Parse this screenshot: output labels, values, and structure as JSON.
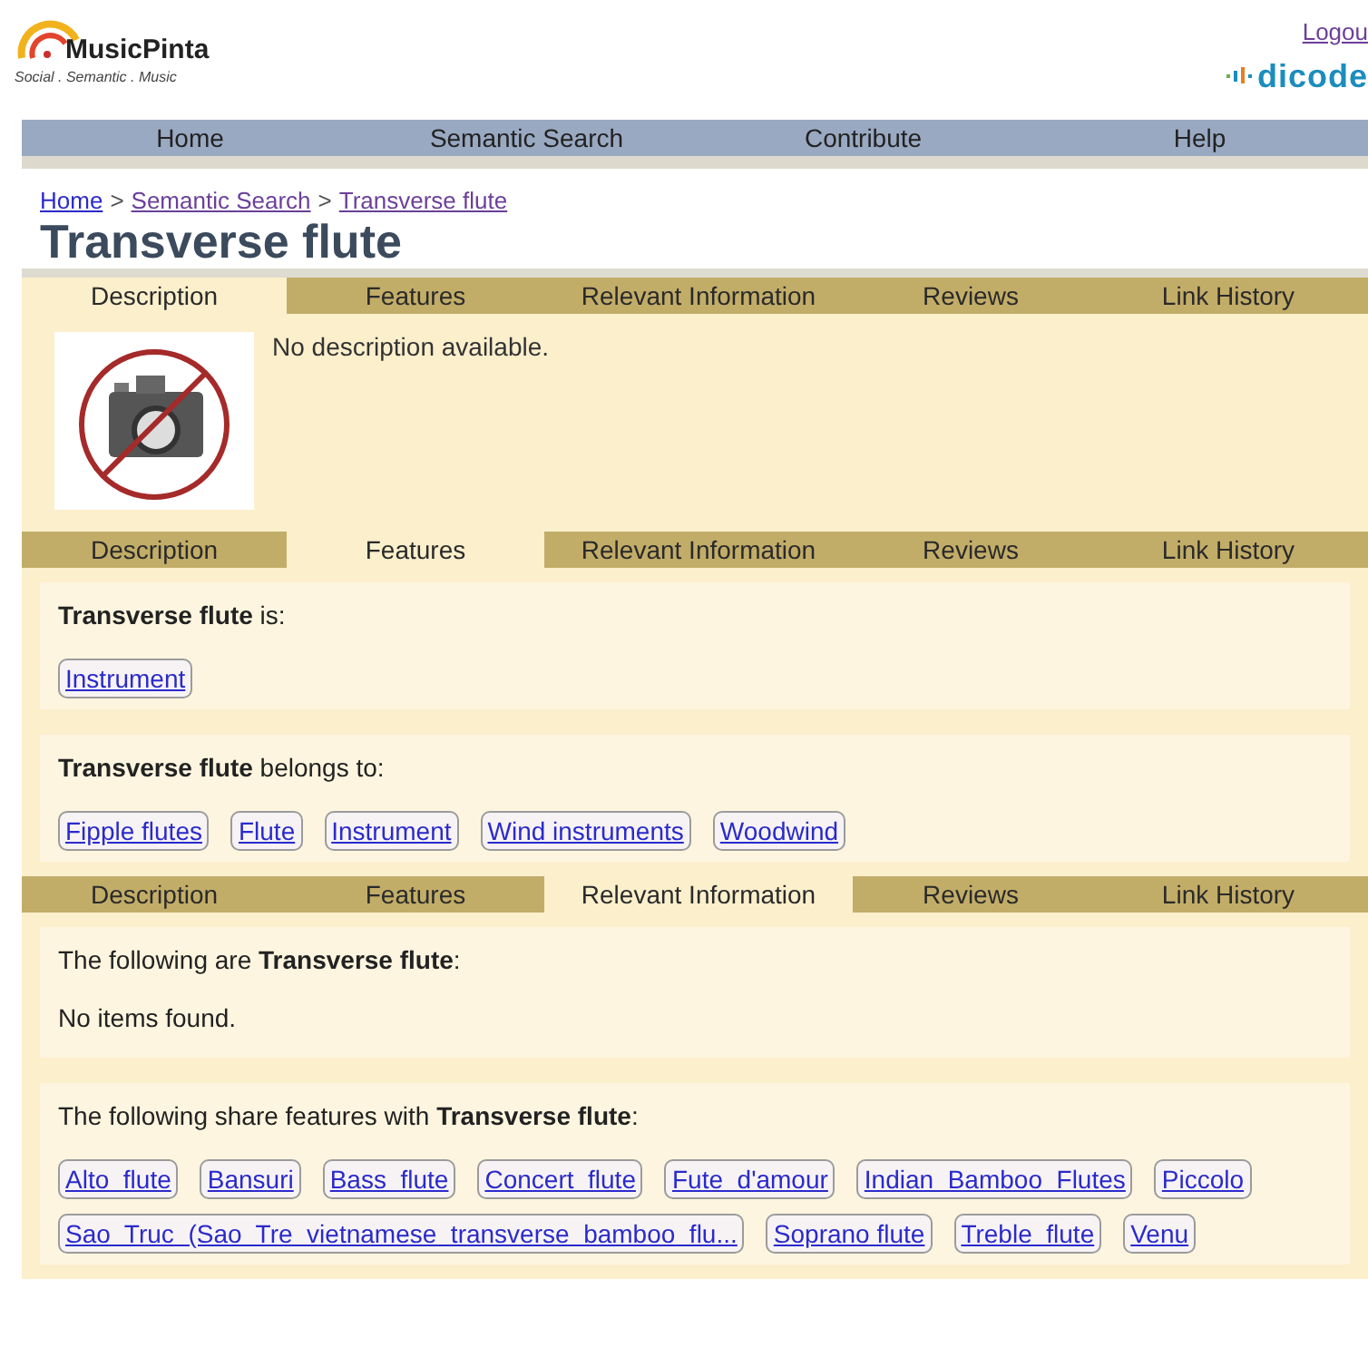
{
  "header": {
    "logo_name": "MusicPinta",
    "tagline": "Social . Semantic . Music",
    "logout": "Logou",
    "partner_logo": "dicode"
  },
  "nav": [
    "Home",
    "Semantic Search",
    "Contribute",
    "Help"
  ],
  "breadcrumb": {
    "separator": ">",
    "items": [
      "Home",
      "Semantic Search",
      "Transverse flute"
    ]
  },
  "title": "Transverse flute",
  "sections": [
    {
      "kind": "description",
      "tabs": [
        {
          "label": "Description",
          "selected": true
        },
        {
          "label": "Features",
          "selected": false
        },
        {
          "label": "Relevant Information",
          "selected": false
        },
        {
          "label": "Reviews",
          "selected": false
        },
        {
          "label": "Link History",
          "selected": false
        }
      ],
      "text": "No description available."
    },
    {
      "kind": "groups",
      "tabs": [
        {
          "label": "Description",
          "selected": false
        },
        {
          "label": "Features",
          "selected": true
        },
        {
          "label": "Relevant Information",
          "selected": false
        },
        {
          "label": "Reviews",
          "selected": false
        },
        {
          "label": "Link History",
          "selected": false
        }
      ],
      "groups": [
        {
          "heading": "**Transverse flute** is:",
          "tags": [
            "Instrument"
          ]
        },
        {
          "heading": "**Transverse flute** belongs to:",
          "tags": [
            "Fipple flutes",
            "Flute",
            "Instrument",
            "Wind instruments",
            "Woodwind"
          ]
        }
      ]
    },
    {
      "kind": "groups",
      "tabs": [
        {
          "label": "Description",
          "selected": false
        },
        {
          "label": "Features",
          "selected": false
        },
        {
          "label": "Relevant Information",
          "selected": true
        },
        {
          "label": "Reviews",
          "selected": false
        },
        {
          "label": "Link History",
          "selected": false
        }
      ],
      "groups": [
        {
          "heading": "The following are **Transverse flute**:",
          "empty": "No items found."
        },
        {
          "heading": "The following share features with **Transverse flute**:",
          "tags": [
            "Alto  flute",
            "Bansuri",
            "Bass  flute",
            "Concert  flute",
            "Fute  d'amour",
            "Indian  Bamboo  Flutes",
            "Piccolo",
            "Sao  Truc  (Sao  Tre  vietnamese  transverse  bamboo  flu...",
            "Soprano flute",
            "Treble  flute",
            "Venu"
          ]
        }
      ]
    }
  ]
}
